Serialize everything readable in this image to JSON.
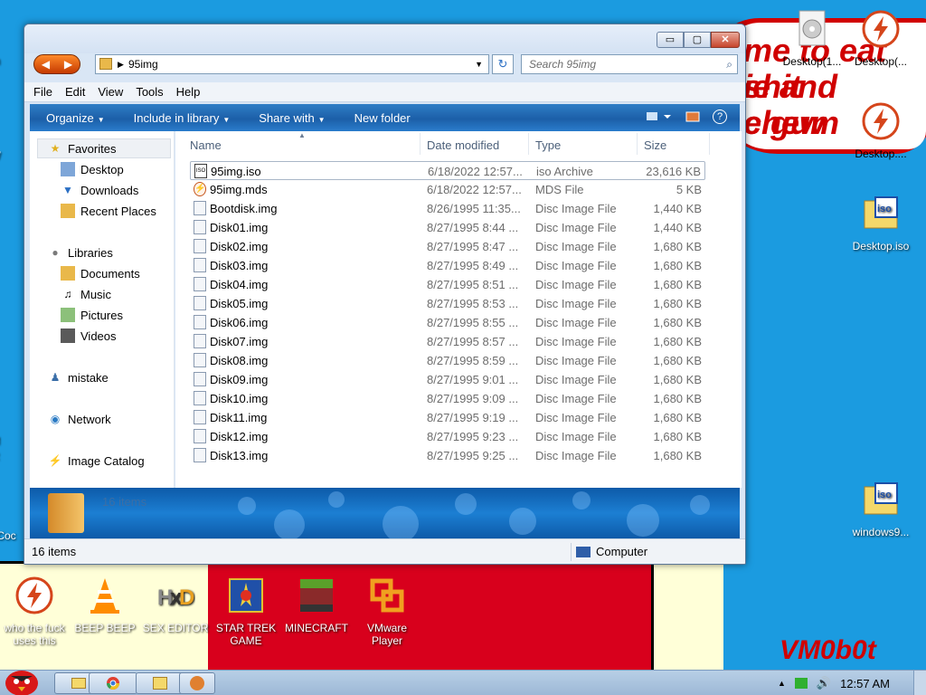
{
  "desktop": {
    "wallpaper_text": [
      "me to eat shit",
      "ie and chew",
      "e gum"
    ],
    "signature": "VM0b0t",
    "icons_right": [
      {
        "label": "Desktop(1...",
        "icon": "cd-file-icon"
      },
      {
        "label": "Desktop(...",
        "icon": "lightning-icon"
      },
      {
        "label": "Desktop....",
        "icon": "lightning-icon"
      },
      {
        "label": "Desktop.iso",
        "icon": "iso-file-icon"
      },
      {
        "label": "windows9...",
        "icon": "iso-file-icon"
      }
    ],
    "icons_bottom": [
      {
        "label": "who the fuck uses this",
        "icon": "lightning-icon"
      },
      {
        "label": "BEEP BEEP",
        "icon": "vlc-cone-icon"
      },
      {
        "label": "SEX EDITOR",
        "icon": "hxd-icon"
      },
      {
        "label": "STAR TREK GAME",
        "icon": "star-trek-icon"
      },
      {
        "label": "MINECRAFT",
        "icon": "minecraft-icon"
      },
      {
        "label": "VMware Player",
        "icon": "vmware-icon"
      }
    ],
    "partial_left_labels": [
      "m",
      "W",
      "M",
      "R",
      "Coc"
    ]
  },
  "window": {
    "path_folder": "95img",
    "search_placeholder": "Search 95img",
    "caption": {
      "minimize": "▭",
      "maximize": "▢",
      "close": "✕"
    },
    "menu": [
      "File",
      "Edit",
      "View",
      "Tools",
      "Help"
    ],
    "toolbar": {
      "organize": "Organize",
      "include": "Include in library",
      "share": "Share with",
      "new_folder": "New folder",
      "help": "?"
    },
    "nav": {
      "favorites": "Favorites",
      "desktop": "Desktop",
      "downloads": "Downloads",
      "recent": "Recent Places",
      "libraries": "Libraries",
      "documents": "Documents",
      "music": "Music",
      "pictures": "Pictures",
      "videos": "Videos",
      "mistake": "mistake",
      "network": "Network",
      "image_catalog": "Image Catalog"
    },
    "columns": {
      "name": "Name",
      "date": "Date modified",
      "type": "Type",
      "size": "Size"
    },
    "files": [
      {
        "name": "95img.iso",
        "date": "6/18/2022 12:57...",
        "type": "iso Archive",
        "size": "23,616 KB",
        "kind": "iso"
      },
      {
        "name": "95img.mds",
        "date": "6/18/2022 12:57...",
        "type": "MDS File",
        "size": "5 KB",
        "kind": "mds"
      },
      {
        "name": "Bootdisk.img",
        "date": "8/26/1995 11:35...",
        "type": "Disc Image File",
        "size": "1,440 KB",
        "kind": "img"
      },
      {
        "name": "Disk01.img",
        "date": "8/27/1995 8:44 ...",
        "type": "Disc Image File",
        "size": "1,440 KB",
        "kind": "img"
      },
      {
        "name": "Disk02.img",
        "date": "8/27/1995 8:47 ...",
        "type": "Disc Image File",
        "size": "1,680 KB",
        "kind": "img"
      },
      {
        "name": "Disk03.img",
        "date": "8/27/1995 8:49 ...",
        "type": "Disc Image File",
        "size": "1,680 KB",
        "kind": "img"
      },
      {
        "name": "Disk04.img",
        "date": "8/27/1995 8:51 ...",
        "type": "Disc Image File",
        "size": "1,680 KB",
        "kind": "img"
      },
      {
        "name": "Disk05.img",
        "date": "8/27/1995 8:53 ...",
        "type": "Disc Image File",
        "size": "1,680 KB",
        "kind": "img"
      },
      {
        "name": "Disk06.img",
        "date": "8/27/1995 8:55 ...",
        "type": "Disc Image File",
        "size": "1,680 KB",
        "kind": "img"
      },
      {
        "name": "Disk07.img",
        "date": "8/27/1995 8:57 ...",
        "type": "Disc Image File",
        "size": "1,680 KB",
        "kind": "img"
      },
      {
        "name": "Disk08.img",
        "date": "8/27/1995 8:59 ...",
        "type": "Disc Image File",
        "size": "1,680 KB",
        "kind": "img"
      },
      {
        "name": "Disk09.img",
        "date": "8/27/1995 9:01 ...",
        "type": "Disc Image File",
        "size": "1,680 KB",
        "kind": "img"
      },
      {
        "name": "Disk10.img",
        "date": "8/27/1995 9:09 ...",
        "type": "Disc Image File",
        "size": "1,680 KB",
        "kind": "img"
      },
      {
        "name": "Disk11.img",
        "date": "8/27/1995 9:19 ...",
        "type": "Disc Image File",
        "size": "1,680 KB",
        "kind": "img"
      },
      {
        "name": "Disk12.img",
        "date": "8/27/1995 9:23 ...",
        "type": "Disc Image File",
        "size": "1,680 KB",
        "kind": "img"
      },
      {
        "name": "Disk13.img",
        "date": "8/27/1995 9:25 ...",
        "type": "Disc Image File",
        "size": "1,680 KB",
        "kind": "img"
      }
    ],
    "details_count": "16 items",
    "status_items": "16 items",
    "status_location": "Computer"
  },
  "taskbar": {
    "clock": "12:57 AM",
    "tray_arrow": "▲"
  },
  "colors": {
    "desktop_blue": "#1b9be0",
    "toolbar_blue": "#1c5fa8",
    "wall_red": "#d10000"
  }
}
